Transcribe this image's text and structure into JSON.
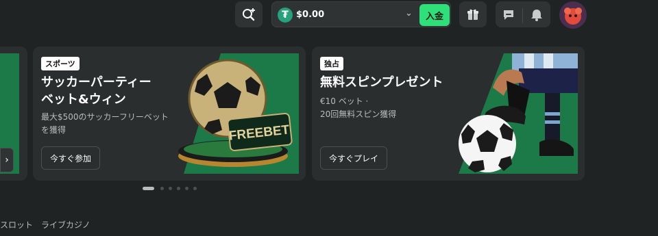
{
  "header": {
    "balance": "$0.00",
    "deposit_label": "入金",
    "currency_icon": "tether-icon",
    "colors": {
      "deposit": "#2fe07a",
      "currency": "#26a17b",
      "promo_green": "#1b7a48"
    }
  },
  "promos": [
    {
      "badge": "スポーツ",
      "title_line1": "サッカーパーティー",
      "title_line2": "ベット&ウィン",
      "desc_line1": "最大$500のサッカーフリーベット",
      "desc_line2": "を獲得",
      "cta": "今すぐ参加",
      "art_text": "FREEBET"
    },
    {
      "badge": "独占",
      "title_line1": "無料スピンプレゼント",
      "desc_line1": "€10 ベット ·",
      "desc_line2": "20回無料スピン獲得",
      "cta": "今すぐプレイ"
    }
  ],
  "carousel": {
    "total": 6,
    "current": 1
  },
  "bottom_nav": [
    "スロット",
    "ライブカジノ"
  ]
}
